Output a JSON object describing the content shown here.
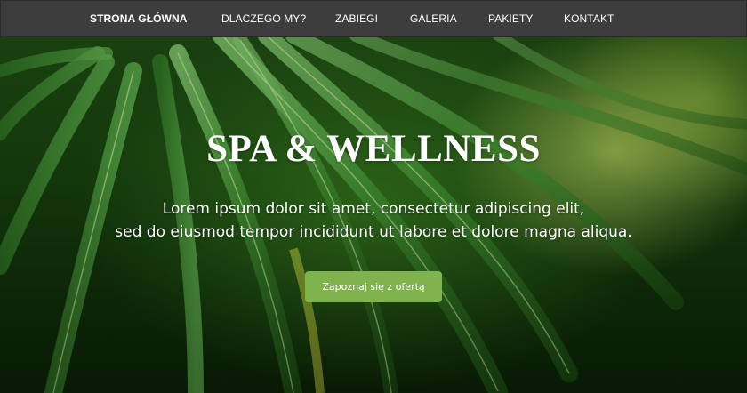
{
  "nav": {
    "items": [
      {
        "label": "STRONA GŁÓWNA",
        "active": true
      },
      {
        "label": "DLACZEGO MY?",
        "active": false
      },
      {
        "label": "ZABIEGI",
        "active": false
      },
      {
        "label": "GALERIA",
        "active": false
      },
      {
        "label": "PAKIETY",
        "active": false
      },
      {
        "label": "KONTAKT",
        "active": false
      }
    ]
  },
  "hero": {
    "title": "SPA & WELLNESS",
    "text_line1": "Lorem ipsum dolor sit amet, consectetur adipiscing elit,",
    "text_line2": "sed do eiusmod tempor incididunt ut labore et dolore magna aliqua.",
    "button_label": "Zapoznaj się z ofertą"
  },
  "colors": {
    "navbar": "#3d3d3d",
    "button": "#7fb44d",
    "foliage_dark": "#143a0c",
    "foliage_light": "#d6e96e"
  }
}
